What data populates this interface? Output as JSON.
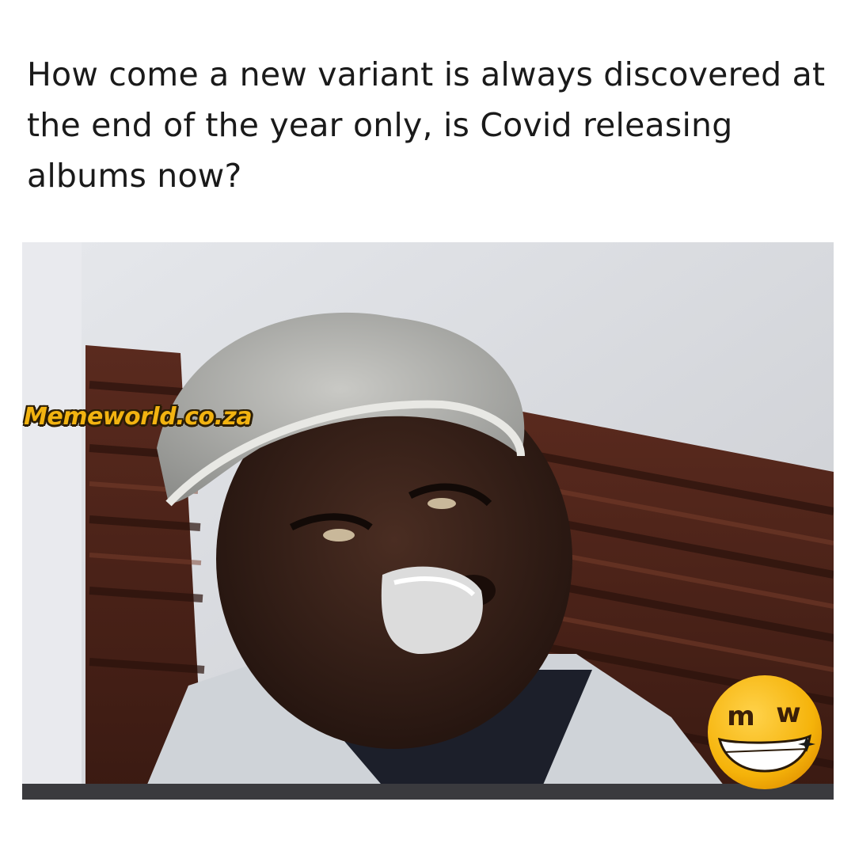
{
  "meme": {
    "caption": "How come a new variant is always discovered at the end of the year only, is Covid releasing albums now?",
    "watermark": "Memeworld.co.za",
    "logo": {
      "left_letter": "m",
      "right_letter": "w"
    },
    "photo_icon": "grinning-person-photo"
  },
  "colors": {
    "background": "#ffffff",
    "caption_text": "#1a1a1a",
    "watermark_fill": "#f2b311",
    "watermark_outline": "#2b1d05",
    "logo_yellow": "#f5b30a"
  }
}
